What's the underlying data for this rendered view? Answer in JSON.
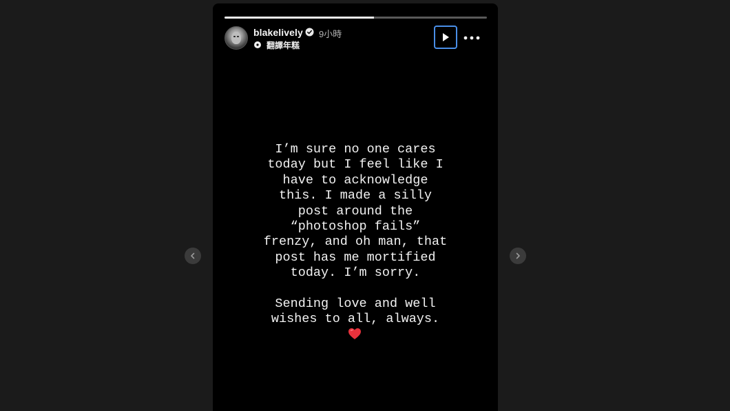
{
  "story": {
    "progress_fraction": 0.57,
    "author": {
      "username": "blakelively",
      "verified": true,
      "posted_ago": "9小時",
      "audio_label": "翻譯年糕"
    },
    "text_paragraphs": [
      [
        "I’m sure no one cares",
        "today but I feel like I",
        "have to acknowledge",
        "this. I made a silly",
        "post around the",
        "“photoshop fails”",
        "frenzy, and oh man, that",
        "post has me mortified",
        "today. I’m sorry."
      ],
      [
        "Sending love and well",
        "wishes to all, always."
      ]
    ],
    "emoji": "heart"
  },
  "icons": {
    "play": "play-icon",
    "more": "more-icon",
    "prev": "chevron-left-icon",
    "next": "chevron-right-icon",
    "verified": "verified-badge-icon",
    "audio": "audio-icon"
  },
  "colors": {
    "page_background": "#1b1b1b",
    "story_background": "#000000",
    "accent_focus": "#4a8fe8",
    "heart": "#e8323c"
  }
}
